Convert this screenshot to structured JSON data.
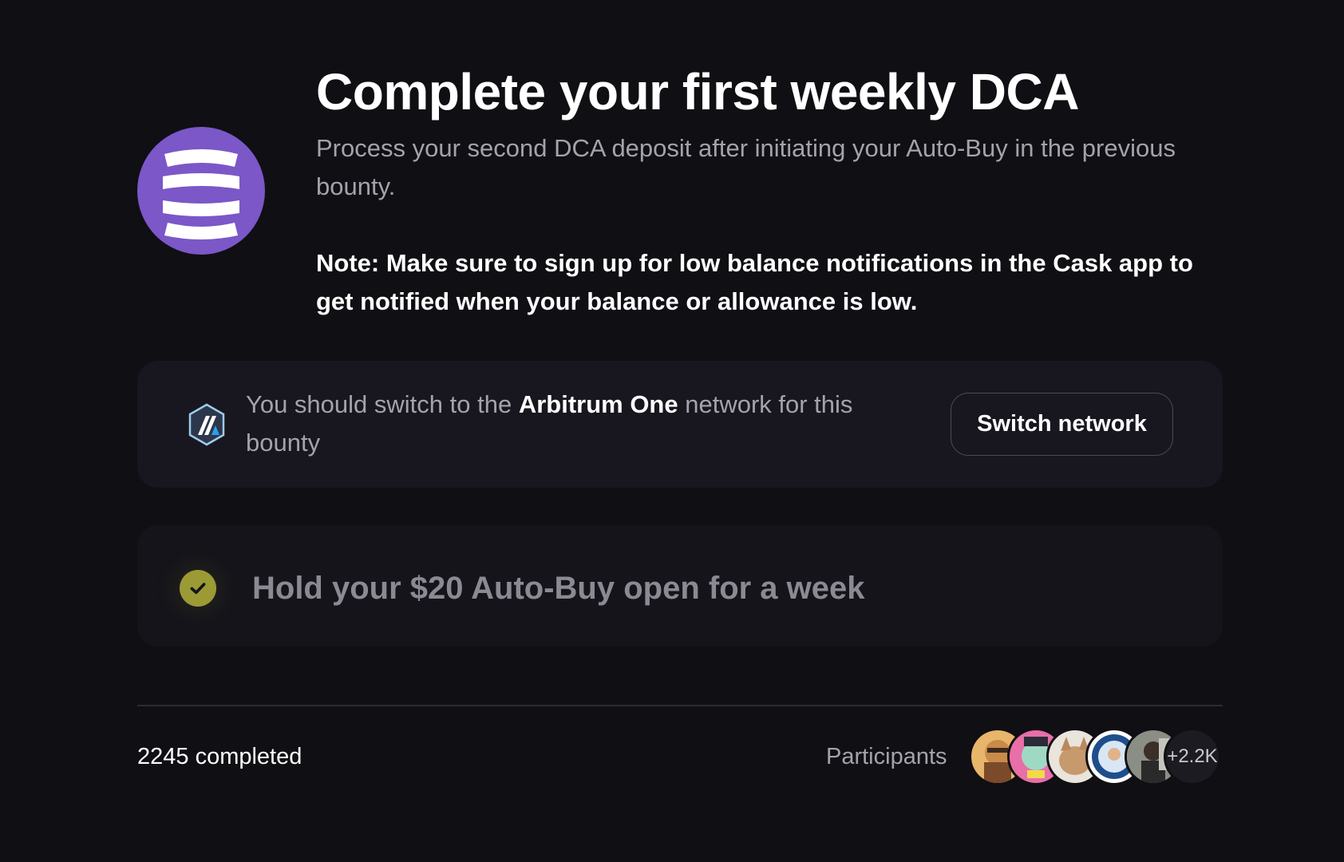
{
  "bounty": {
    "title": "Complete your first weekly DCA",
    "description": "Process your second DCA deposit after initiating your Auto-Buy in the previous bounty.",
    "note": "Note: Make sure to sign up for low balance notifications in the Cask app to get notified when your balance or allowance is low.",
    "logo_icon": "cask-logo-icon",
    "accent_color": "#7b57c8"
  },
  "network_notice": {
    "prefix": "You should switch to the ",
    "network_name": "Arbitrum One",
    "suffix": " network for this bounty",
    "icon": "arbitrum-icon",
    "button_label": "Switch network"
  },
  "task": {
    "label": "Hold your $20 Auto-Buy open for a week",
    "status": "completed",
    "status_icon": "check-icon",
    "status_color": "#9c9a35"
  },
  "footer": {
    "completed_text": "2245 completed",
    "participants_label": "Participants",
    "more_count": "+2.2K",
    "avatars": [
      "avatar-1",
      "avatar-2",
      "avatar-3",
      "avatar-4",
      "avatar-5"
    ]
  }
}
